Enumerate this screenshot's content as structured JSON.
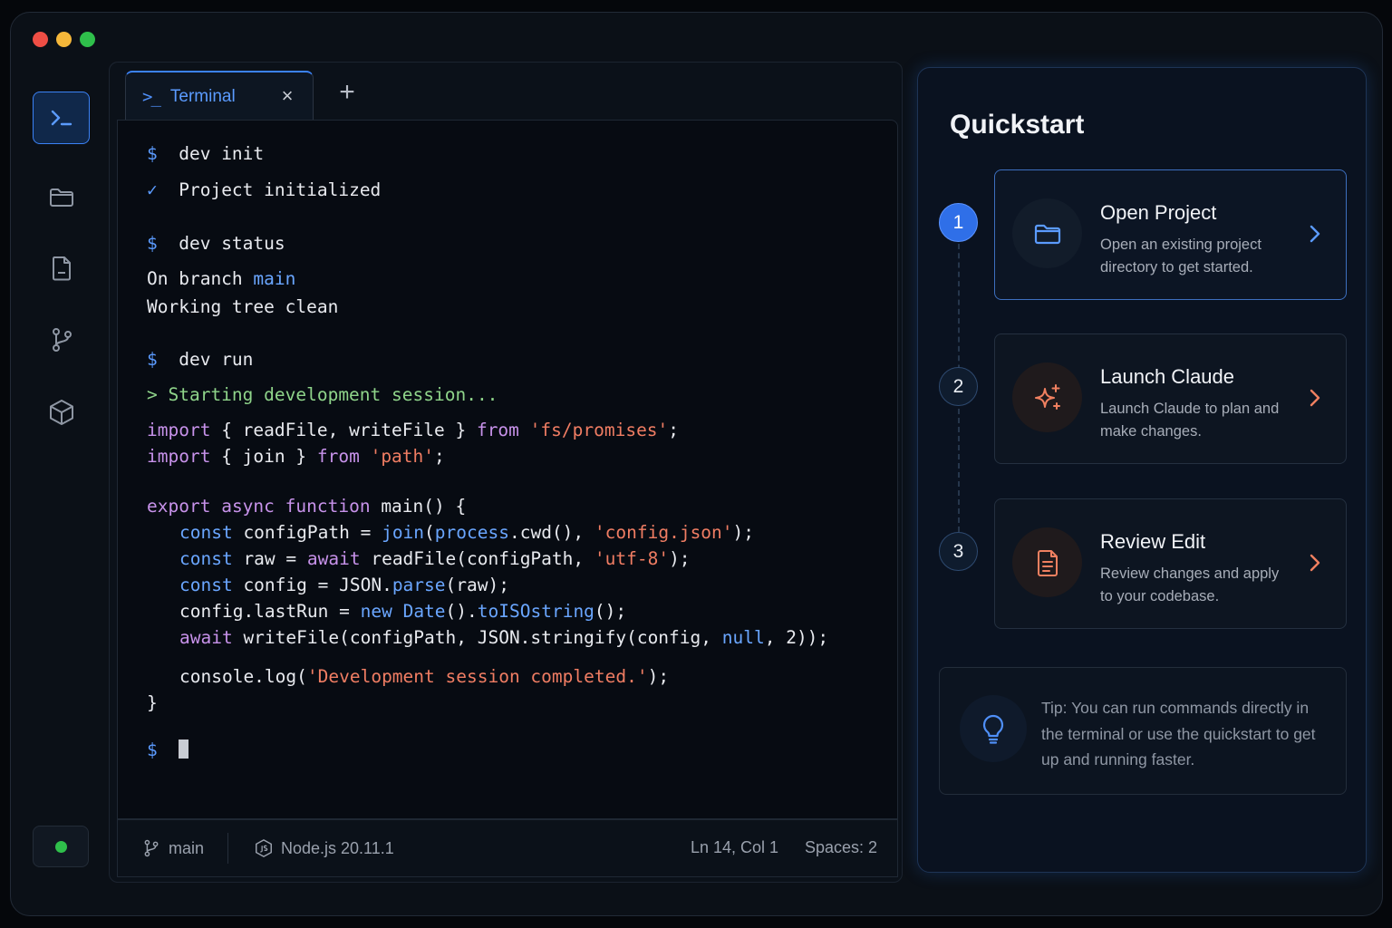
{
  "sidebar": {
    "items": [
      {
        "icon": "terminal-icon",
        "active": true
      },
      {
        "icon": "folder-icon",
        "active": false
      },
      {
        "icon": "file-icon",
        "active": false
      },
      {
        "icon": "git-branch-icon",
        "active": false
      },
      {
        "icon": "cube-icon",
        "active": false
      }
    ],
    "status_color": "#2fbf4b"
  },
  "terminal": {
    "tab": {
      "icon": ">_",
      "label": "Terminal",
      "close": "×"
    },
    "add_tab": "+",
    "prompt": "$",
    "check": "✓",
    "lines": {
      "cmd_init": "dev init",
      "init_result": "Project initialized",
      "cmd_status": "dev status",
      "branch_prefix": "On branch ",
      "branch_name": "main",
      "tree": "Working tree clean",
      "cmd_run": "dev run",
      "starting": "> Starting development session..."
    },
    "code": {
      "import": "import",
      "from": "from",
      "export": "export",
      "async": "async",
      "function": "function",
      "const": "const",
      "await": "await",
      "new": "new",
      "null": "null",
      "l1_a": " { readFile, writeFile } ",
      "l1_str": "'fs/promises'",
      "semi": ";",
      "l2_a": " { join } ",
      "l2_str": "'path'",
      "l3_a": " main() {",
      "l4_a": " configPath = ",
      "l4_join": "join",
      "l4_b": "(",
      "l4_process": "process",
      "l4_c": ".cwd(), ",
      "l4_str": "'config.json'",
      "close_semi": ");",
      "l5_a": " raw = ",
      "l5_b": " readFile(configPath, ",
      "l5_str": "'utf-8'",
      "l6_a": " config = JSON.",
      "l6_parse": "parse",
      "l6_b": "(raw);",
      "l7_a": "config.lastRun = ",
      "l7_date": "Date",
      "l7_b": "().",
      "l7_iso": "toISOstring",
      "l7_c": "();",
      "l8_a": " writeFile(configPath, JSON.stringify(config, ",
      "l8_b": ", 2));",
      "l9_a": "console.log(",
      "l9_str": "'Development session completed.'",
      "l10": "}"
    }
  },
  "status_bar": {
    "branch": "main",
    "node": "Node.js 20.11.1",
    "position": "Ln 14, Col 1",
    "spaces": "Spaces: 2"
  },
  "quickstart": {
    "title": "Quickstart",
    "steps": [
      {
        "num": "1",
        "title": "Open Project",
        "desc": "Open an existing project directory to get started.",
        "icon": "folder-icon"
      },
      {
        "num": "2",
        "title": "Launch Claude",
        "desc": "Launch Claude to plan and make changes.",
        "icon": "sparkle-icon"
      },
      {
        "num": "3",
        "title": "Review Edit",
        "desc": "Review changes and apply to your codebase.",
        "icon": "document-icon"
      }
    ],
    "tip": "Tip: You can run commands directly in the terminal or use the quickstart to get up and running faster."
  },
  "colors": {
    "accent": "#3b82f6",
    "warm_icon": "#f08060",
    "string": "#f07d63",
    "keyword": "#c792ea",
    "success": "#8fd48a"
  }
}
